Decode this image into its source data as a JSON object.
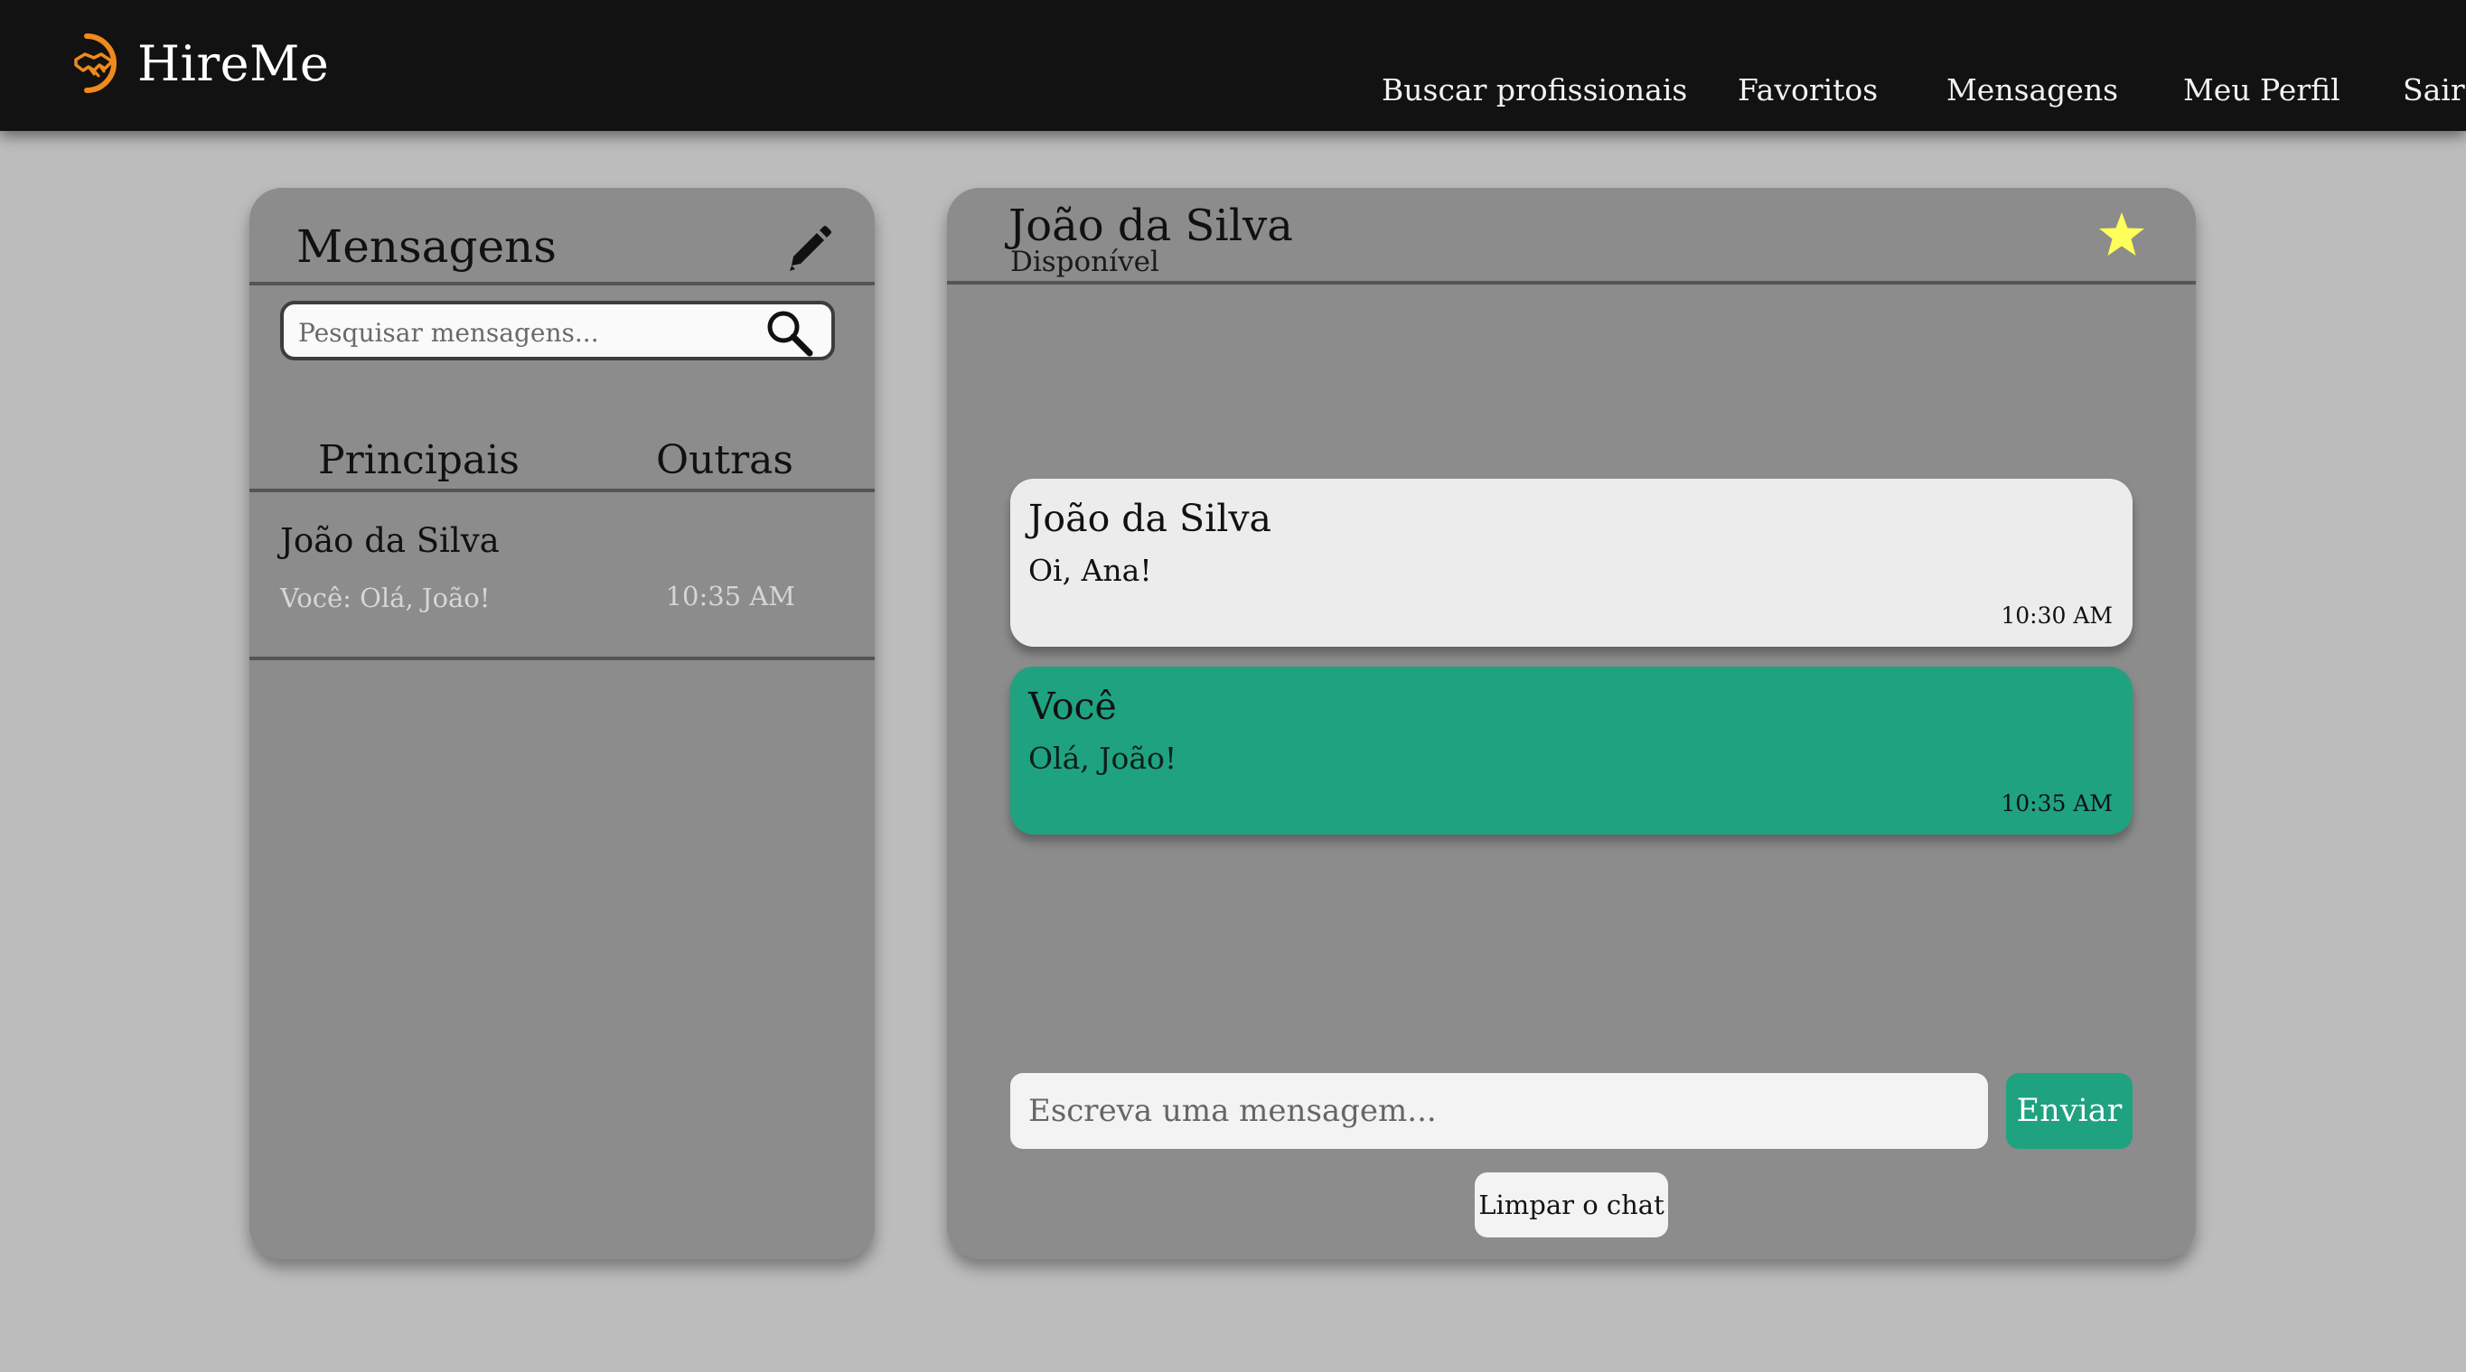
{
  "brand": {
    "name": "HireMe",
    "logo_icon": "handshake-icon",
    "accent_color": "#f08a1c"
  },
  "nav": {
    "items": [
      {
        "label": "Buscar profissionais"
      },
      {
        "label": "Favoritos"
      },
      {
        "label": "Mensagens"
      },
      {
        "label": "Meu Perfil"
      },
      {
        "label": "Sair"
      }
    ]
  },
  "sidebar": {
    "title": "Mensagens",
    "compose_icon": "pencil-icon",
    "search": {
      "placeholder": "Pesquisar mensagens...",
      "value": "",
      "icon": "search-icon"
    },
    "tabs": [
      {
        "label": "Principais"
      },
      {
        "label": "Outras"
      }
    ],
    "conversations": [
      {
        "name": "João da Silva",
        "preview": "Você: Olá, João!",
        "time": "10:35 AM"
      }
    ]
  },
  "chat": {
    "contact_name": "João da Silva",
    "contact_status": "Disponível",
    "favorite_icon": "star-icon",
    "favorite_color": "#ffff5a",
    "messages": [
      {
        "sender": "João da Silva",
        "text": "Oi, Ana!",
        "time": "10:30 AM",
        "direction": "incoming",
        "color": "#ececec"
      },
      {
        "sender": "Você",
        "text": "Olá, João!",
        "time": "10:35 AM",
        "direction": "outgoing",
        "color": "#1fa280"
      }
    ],
    "composer": {
      "placeholder": "Escreva uma mensagem...",
      "value": "",
      "send_label": "Enviar",
      "clear_label": "Limpar o chat"
    }
  }
}
